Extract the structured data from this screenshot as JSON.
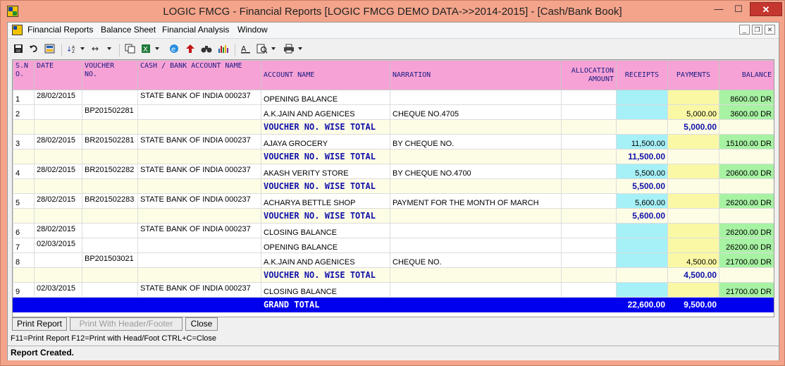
{
  "window": {
    "title": "LOGIC FMCG - Financial Reports  [LOGIC FMCG DEMO DATA->>2014-2015] - [Cash/Bank Book]",
    "min": "—",
    "max": "☐",
    "close": "✕"
  },
  "menu": {
    "items": [
      "Financial Reports",
      "Balance Sheet",
      "Financial Analysis",
      "Window"
    ],
    "mdi_min": "_",
    "mdi_restore": "❐",
    "mdi_close": "✕"
  },
  "toolbar": {
    "icons": [
      "save-icon",
      "undo-icon",
      "preview-icon",
      "sort-icon",
      "columns-icon",
      "copy-icon",
      "excel-icon",
      "ie-icon",
      "export-icon",
      "find-icon",
      "chart-icon",
      "font-icon",
      "zoom-icon",
      "print-icon"
    ]
  },
  "table": {
    "headers": {
      "sno": "S.N\nO.",
      "date": "DATE",
      "voucher": "VOUCHER\nNO.",
      "cash_bank": "CASH / BANK ACCOUNT NAME",
      "account": "ACCOUNT NAME",
      "narration": "NARRATION",
      "allocation": "ALLOCATION\nAMOUNT",
      "receipts": "RECEIPTS",
      "payments": "PAYMENTS",
      "balance": "BALANCE"
    },
    "rows": [
      {
        "kind": "entry",
        "sno": "1",
        "date": "28/02/2015",
        "voucher": "",
        "cash_bank": "STATE BANK OF INDIA 000237",
        "account": "OPENING BALANCE",
        "narration": "",
        "allocation": "",
        "receipts": "",
        "payments": "",
        "balance": "8600.00 DR"
      },
      {
        "kind": "entry",
        "sno": "2",
        "date": "",
        "voucher": "BP201502281",
        "cash_bank": "",
        "account": "A.K.JAIN AND AGENICES",
        "narration": "CHEQUE NO.4705",
        "allocation": "",
        "receipts": "",
        "payments": "5,000.00",
        "balance": "3600.00 DR"
      },
      {
        "kind": "total",
        "label": "VOUCHER NO. WISE TOTAL",
        "receipts": "",
        "payments": "5,000.00"
      },
      {
        "kind": "entry",
        "sno": "3",
        "date": "28/02/2015",
        "voucher": "BR201502281",
        "cash_bank": "STATE BANK OF INDIA 000237",
        "account": "AJAYA GROCERY",
        "narration": "BY CHEQUE NO.",
        "allocation": "",
        "receipts": "11,500.00",
        "payments": "",
        "balance": "15100.00 DR"
      },
      {
        "kind": "total",
        "label": "VOUCHER NO. WISE TOTAL",
        "receipts": "11,500.00",
        "payments": ""
      },
      {
        "kind": "entry",
        "sno": "4",
        "date": "28/02/2015",
        "voucher": "BR201502282",
        "cash_bank": "STATE BANK OF INDIA 000237",
        "account": "AKASH VERITY STORE",
        "narration": "BY CHEQUE NO.4700",
        "allocation": "",
        "receipts": "5,500.00",
        "payments": "",
        "balance": "20600.00 DR"
      },
      {
        "kind": "total",
        "label": "VOUCHER NO. WISE TOTAL",
        "receipts": "5,500.00",
        "payments": ""
      },
      {
        "kind": "entry",
        "sno": "5",
        "date": "28/02/2015",
        "voucher": "BR201502283",
        "cash_bank": "STATE BANK OF INDIA 000237",
        "account": "ACHARYA BETTLE SHOP",
        "narration": "PAYMENT FOR THE MONTH OF MARCH",
        "allocation": "",
        "receipts": "5,600.00",
        "payments": "",
        "balance": "26200.00 DR"
      },
      {
        "kind": "total",
        "label": "VOUCHER NO. WISE TOTAL",
        "receipts": "5,600.00",
        "payments": ""
      },
      {
        "kind": "entry",
        "sno": "6",
        "date": "28/02/2015",
        "voucher": "",
        "cash_bank": "STATE BANK OF INDIA 000237",
        "account": "CLOSING BALANCE",
        "narration": "",
        "allocation": "",
        "receipts": "",
        "payments": "",
        "balance": "26200.00 DR"
      },
      {
        "kind": "entry",
        "sno": "7",
        "date": "02/03/2015",
        "voucher": "",
        "cash_bank": "",
        "account": "OPENING BALANCE",
        "narration": "",
        "allocation": "",
        "receipts": "",
        "payments": "",
        "balance": "26200.00 DR"
      },
      {
        "kind": "entry",
        "sno": "8",
        "date": "",
        "voucher": "BP201503021",
        "cash_bank": "",
        "account": "A.K.JAIN AND AGENICES",
        "narration": "CHEQUE NO.",
        "allocation": "",
        "receipts": "",
        "payments": "4,500.00",
        "balance": "21700.00 DR"
      },
      {
        "kind": "total",
        "label": "VOUCHER NO. WISE TOTAL",
        "receipts": "",
        "payments": "4,500.00"
      },
      {
        "kind": "entry",
        "sno": "9",
        "date": "02/03/2015",
        "voucher": "",
        "cash_bank": "STATE BANK OF INDIA 000237",
        "account": "CLOSING BALANCE",
        "narration": "",
        "allocation": "",
        "receipts": "",
        "payments": "",
        "balance": "21700.00 DR"
      }
    ],
    "grand_total": {
      "label": "GRAND TOTAL",
      "receipts": "22,600.00",
      "payments": "9,500.00"
    }
  },
  "buttons": {
    "print_report": "Print Report",
    "print_header": "Print With Header/Footer",
    "close": "Close"
  },
  "hotkeys": "F11=Print Report  F12=Print with Head/Foot  CTRL+C=Close",
  "status": "Report Created."
}
